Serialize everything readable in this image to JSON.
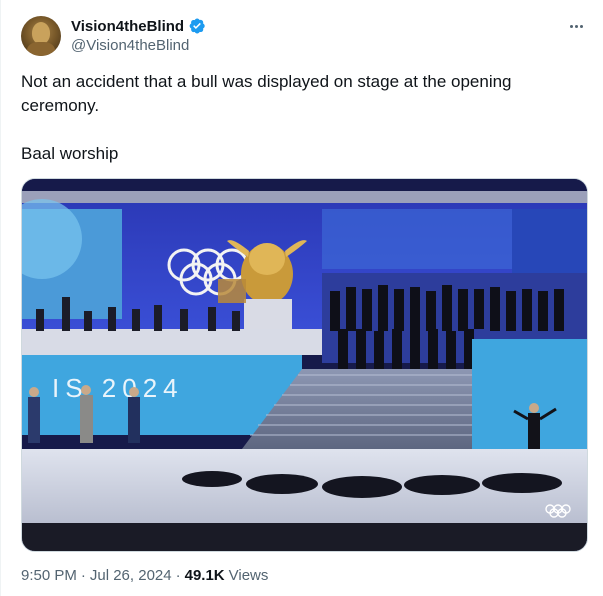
{
  "author": {
    "display_name": "Vision4theBlind",
    "handle": "@Vision4theBlind",
    "verified": true
  },
  "tweet": {
    "lines": [
      "Not an accident that a bull was displayed on stage at the opening ceremony.",
      "Baal worship"
    ]
  },
  "media": {
    "stage_text": "IS 2024"
  },
  "meta": {
    "time": "9:50 PM",
    "separator1": "·",
    "date": "Jul 26, 2024",
    "separator2": "·",
    "views_count": "49.1K",
    "views_label": "Views"
  },
  "colors": {
    "verified": "#1d9bf0",
    "secondary_text": "#536471",
    "primary_text": "#0f1419",
    "stage_blue": "#2b3cc4"
  },
  "icons": {
    "verified": "verified-badge-icon",
    "more": "more-options-icon"
  }
}
